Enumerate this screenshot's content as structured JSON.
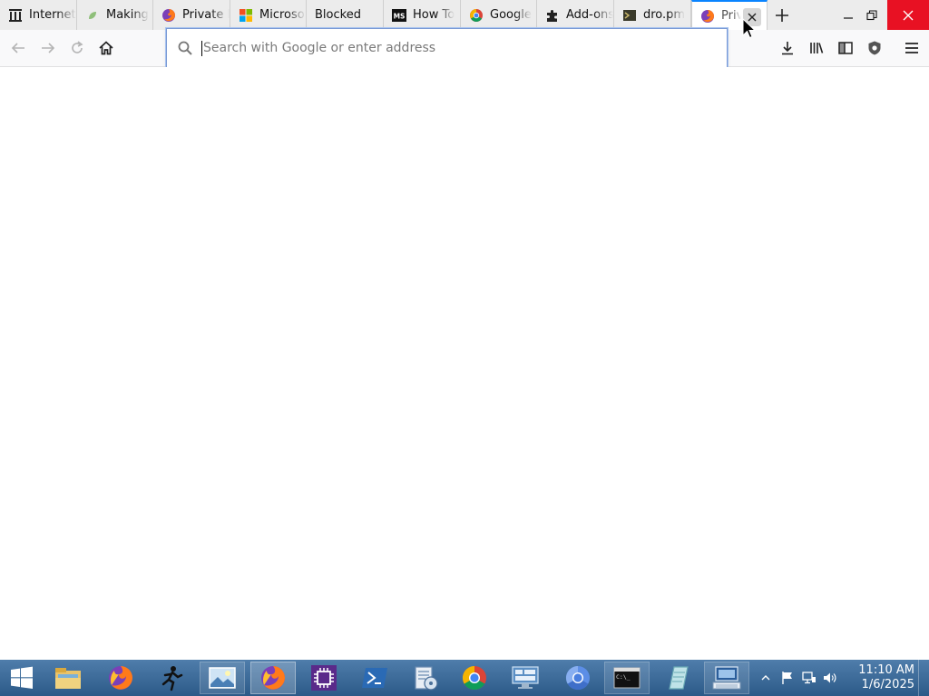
{
  "browser": {
    "tabs": [
      {
        "label": "Internet Archive",
        "icon": "archive-icon"
      },
      {
        "label": "Making",
        "icon": "leaf-icon"
      },
      {
        "label": "Private Browsing",
        "icon": "firefox-icon"
      },
      {
        "label": "Microsoft",
        "icon": "microsoft-icon"
      },
      {
        "label": "Blocked",
        "icon": ""
      },
      {
        "label": "How To",
        "icon": "ms-icon"
      },
      {
        "label": "Google",
        "icon": "chrome-icon"
      },
      {
        "label": "Add-ons",
        "icon": "puzzle-icon"
      },
      {
        "label": "dro.pm",
        "icon": "dro-icon"
      },
      {
        "label": "Private Browsing",
        "icon": "firefox-icon",
        "active": true
      }
    ],
    "new_tab_label": "+",
    "urlbar": {
      "placeholder": "Search with Google or enter address",
      "value": ""
    }
  },
  "taskbar": {
    "apps": [
      "windows-start-icon",
      "file-explorer-icon",
      "firefox-icon",
      "runner-icon",
      "photos-icon",
      "firefox-icon",
      "chip-icon",
      "powershell-icon",
      "disk-tool-icon",
      "chrome-icon",
      "network-icon",
      "chromium-icon",
      "cmd-icon",
      "notepad-icon",
      "rdp-icon"
    ],
    "clock": {
      "time": "11:10 AM",
      "date": "1/6/2025"
    }
  }
}
